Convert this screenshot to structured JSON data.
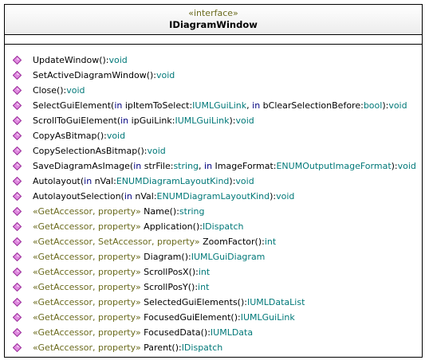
{
  "interface": {
    "stereotype": "«interface»",
    "name": "IDiagramWindow"
  },
  "operations": [
    {
      "stereo": "",
      "prefix": "UpdateWindow(",
      "params": [],
      "suffix": "):",
      "ret": "void"
    },
    {
      "stereo": "",
      "prefix": "SetActiveDiagramWindow(",
      "params": [],
      "suffix": "):",
      "ret": "void"
    },
    {
      "stereo": "",
      "prefix": "Close(",
      "params": [],
      "suffix": "):",
      "ret": "void"
    },
    {
      "stereo": "",
      "prefix": "SelectGuiElement(",
      "params": [
        {
          "kw": "in",
          "name": " ipItemToSelect:",
          "type": "IUMLGuiLink",
          "sep": ", "
        },
        {
          "kw": "in",
          "name": " bClearSelectionBefore:",
          "type": "bool",
          "sep": ""
        }
      ],
      "suffix": "):",
      "ret": "void"
    },
    {
      "stereo": "",
      "prefix": "ScrollToGuiElement(",
      "params": [
        {
          "kw": "in",
          "name": " ipGuiLink:",
          "type": "IUMLGuiLink",
          "sep": ""
        }
      ],
      "suffix": "):",
      "ret": "void"
    },
    {
      "stereo": "",
      "prefix": "CopyAsBitmap(",
      "params": [],
      "suffix": "):",
      "ret": "void"
    },
    {
      "stereo": "",
      "prefix": "CopySelectionAsBitmap(",
      "params": [],
      "suffix": "):",
      "ret": "void"
    },
    {
      "stereo": "",
      "prefix": "SaveDiagramAsImage(",
      "params": [
        {
          "kw": "in",
          "name": " strFile:",
          "type": "string",
          "sep": ", "
        },
        {
          "kw": "in",
          "name": " ImageFormat:",
          "type": "ENUMOutputImageFormat",
          "sep": ""
        }
      ],
      "suffix": "):",
      "ret": "void"
    },
    {
      "stereo": "",
      "prefix": "Autolayout(",
      "params": [
        {
          "kw": "in",
          "name": " nVal:",
          "type": "ENUMDiagramLayoutKind",
          "sep": ""
        }
      ],
      "suffix": "):",
      "ret": "void"
    },
    {
      "stereo": "",
      "prefix": "AutolayoutSelection(",
      "params": [
        {
          "kw": "in",
          "name": " nVal:",
          "type": "ENUMDiagramLayoutKind",
          "sep": ""
        }
      ],
      "suffix": "):",
      "ret": "void"
    },
    {
      "stereo": "«GetAccessor, property» ",
      "prefix": "Name(",
      "params": [],
      "suffix": "):",
      "ret": "string"
    },
    {
      "stereo": "«GetAccessor, property» ",
      "prefix": "Application(",
      "params": [],
      "suffix": "):",
      "ret": "IDispatch"
    },
    {
      "stereo": "«GetAccessor, SetAccessor, property» ",
      "prefix": "ZoomFactor(",
      "params": [],
      "suffix": "):",
      "ret": "int"
    },
    {
      "stereo": "«GetAccessor, property» ",
      "prefix": "Diagram(",
      "params": [],
      "suffix": "):",
      "ret": "IUMLGuiDiagram"
    },
    {
      "stereo": "«GetAccessor, property» ",
      "prefix": "ScrollPosX(",
      "params": [],
      "suffix": "):",
      "ret": "int"
    },
    {
      "stereo": "«GetAccessor, property» ",
      "prefix": "ScrollPosY(",
      "params": [],
      "suffix": "):",
      "ret": "int"
    },
    {
      "stereo": "«GetAccessor, property» ",
      "prefix": "SelectedGuiElements(",
      "params": [],
      "suffix": "):",
      "ret": "IUMLDataList"
    },
    {
      "stereo": "«GetAccessor, property» ",
      "prefix": "FocusedGuiElement(",
      "params": [],
      "suffix": "):",
      "ret": "IUMLGuiLink"
    },
    {
      "stereo": "«GetAccessor, property» ",
      "prefix": "FocusedData(",
      "params": [],
      "suffix": "):",
      "ret": "IUMLData"
    },
    {
      "stereo": "«GetAccessor, property» ",
      "prefix": "Parent(",
      "params": [],
      "suffix": "):",
      "ret": "IDispatch"
    }
  ]
}
